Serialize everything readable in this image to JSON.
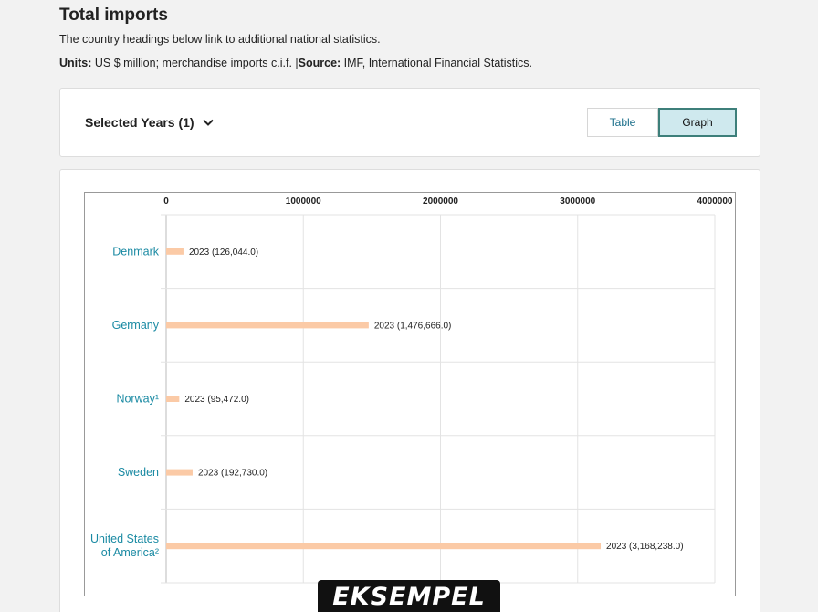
{
  "header": {
    "title": "Total imports",
    "intro": "The country headings below link to additional national statistics.",
    "units_label": "Units:",
    "units_value": " US $ million; merchandise imports c.i.f. |",
    "source_label": "Source:",
    "source_value": " IMF, International Financial Statistics."
  },
  "controls": {
    "years_label": "Selected Years (1)",
    "table_label": "Table",
    "graph_label": "Graph",
    "active_view": "Graph"
  },
  "watermark": "EKSEMPEL",
  "colors": {
    "bar": "#fbcaa6",
    "country_link": "#1a8aa3",
    "grid": "#e3e3e3",
    "toggle_active_bg": "#cfe9ee",
    "toggle_active_border": "#3d7f7a"
  },
  "chart_data": {
    "type": "bar",
    "orientation": "horizontal",
    "title": "",
    "xlabel": "",
    "ylabel": "",
    "xlim": [
      0,
      4000000
    ],
    "x_ticks": [
      0,
      1000000,
      2000000,
      3000000,
      4000000
    ],
    "x_tick_labels": [
      "0",
      "1000000",
      "2000000",
      "3000000",
      "4000000"
    ],
    "x_axis_position": "top",
    "grid": true,
    "legend": false,
    "categories": [
      {
        "lines": [
          "Denmark"
        ],
        "is_link": true
      },
      {
        "lines": [
          "Germany"
        ],
        "is_link": true
      },
      {
        "lines": [
          "Norway¹"
        ],
        "is_link": true
      },
      {
        "lines": [
          "Sweden"
        ],
        "is_link": true
      },
      {
        "lines": [
          "United States",
          "of America²"
        ],
        "is_link": true
      }
    ],
    "series": [
      {
        "year": "2023",
        "values": [
          126044.0,
          1476666.0,
          95472.0,
          192730.0,
          3168238.0
        ],
        "labels": [
          "2023 (126,044.0)",
          "2023 (1,476,666.0)",
          "2023 (95,472.0)",
          "2023 (192,730.0)",
          "2023 (3,168,238.0)"
        ]
      }
    ]
  }
}
